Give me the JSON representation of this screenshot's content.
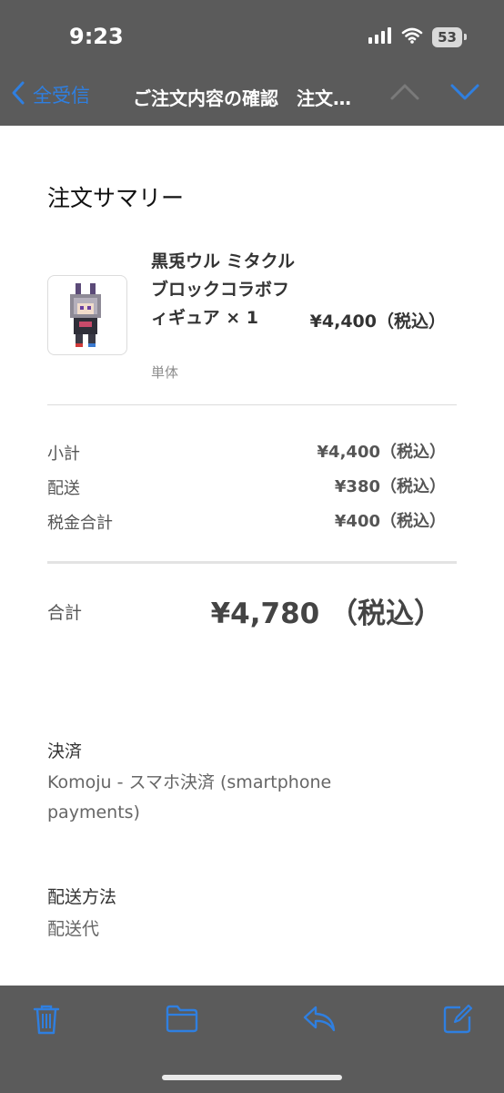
{
  "status_bar": {
    "time": "9:23",
    "battery": "53"
  },
  "nav": {
    "back_label": "全受信",
    "subject": "ご注文内容の確認　注文…"
  },
  "order": {
    "summary_title": "注文サマリー",
    "item": {
      "name": "黒兎ウル ミタクルブロックコラボフィギュア × 1",
      "variant": "単体",
      "price": "¥4,400（税込）"
    },
    "subtotal_label": "小計",
    "subtotal_value": "¥4,400（税込）",
    "shipping_label": "配送",
    "shipping_value": "¥380（税込）",
    "tax_label": "税金合計",
    "tax_value": "¥400（税込）",
    "total_label": "合計",
    "total_value": "¥4,780 （税込）"
  },
  "payment": {
    "heading": "決済",
    "method": "Komoju - スマホ決済 (smartphone payments)"
  },
  "delivery": {
    "heading": "配送方法",
    "method": "配送代"
  },
  "colors": {
    "accent": "#2f7fe0",
    "bar_background": "#5b5b5b"
  },
  "toolbar": {
    "icons": [
      "trash-icon",
      "folder-icon",
      "reply-icon",
      "compose-icon"
    ]
  }
}
